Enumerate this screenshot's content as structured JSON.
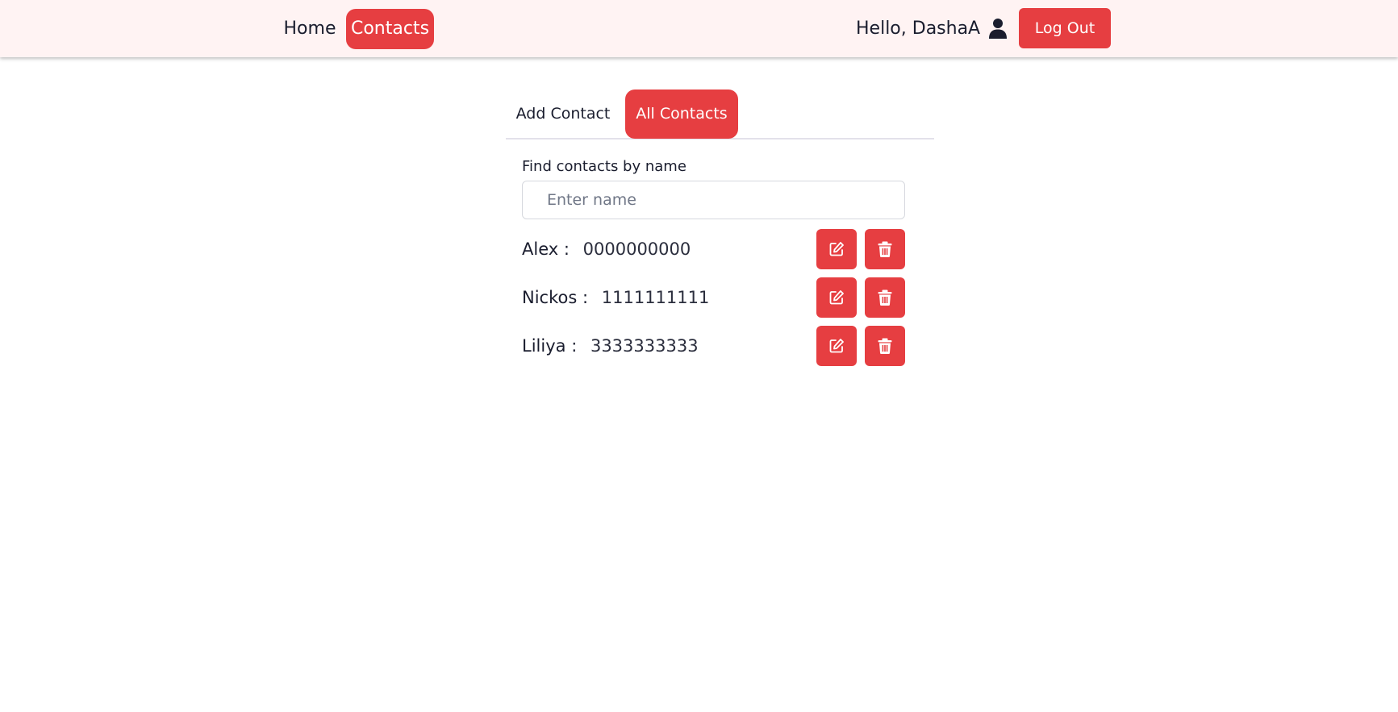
{
  "header": {
    "nav": {
      "home_label": "Home",
      "contacts_label": "Contacts"
    },
    "greeting": "Hello, DashaA",
    "user_icon": "user-icon",
    "logout_label": "Log Out"
  },
  "tabs": {
    "add_label": "Add Contact",
    "all_label": "All Contacts",
    "active": "All Contacts"
  },
  "filter": {
    "label": "Find contacts by name",
    "placeholder": "Enter name",
    "value": ""
  },
  "contacts": [
    {
      "name": "Alex",
      "separator": ":",
      "phone": "0000000000"
    },
    {
      "name": "Nickos",
      "separator": ":",
      "phone": "1111111111"
    },
    {
      "name": "Liliya",
      "separator": ":",
      "phone": "3333333333"
    }
  ],
  "row_icons": {
    "edit": "edit-icon",
    "delete": "trash-icon"
  },
  "colors": {
    "accent": "#e63e41",
    "header_bg": "#fff3f3",
    "text": "#1a1d2e"
  }
}
